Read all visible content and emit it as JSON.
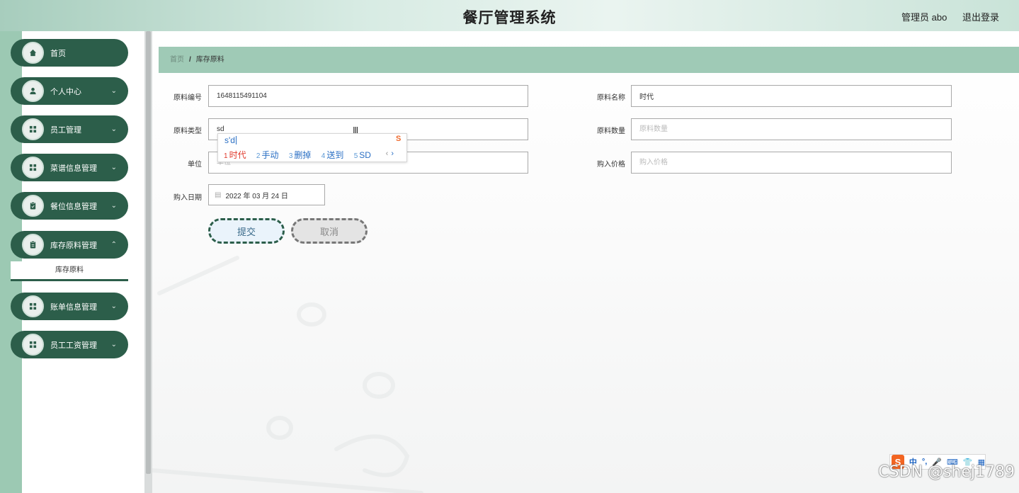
{
  "header": {
    "title": "餐厅管理系统",
    "user": "管理员 abo",
    "logout": "退出登录"
  },
  "sidebar": {
    "items": [
      {
        "label": "首页",
        "icon": "home-icon",
        "has_children": false
      },
      {
        "label": "个人中心",
        "icon": "user-icon",
        "has_children": true
      },
      {
        "label": "员工管理",
        "icon": "grid-icon",
        "has_children": true
      },
      {
        "label": "菜谱信息管理",
        "icon": "grid-icon",
        "has_children": true
      },
      {
        "label": "餐位信息管理",
        "icon": "clipboard-icon",
        "has_children": true
      },
      {
        "label": "库存原料管理",
        "icon": "document-icon",
        "has_children": true,
        "expanded": true
      },
      {
        "label": "账单信息管理",
        "icon": "grid-icon",
        "has_children": true
      },
      {
        "label": "员工工资管理",
        "icon": "grid-icon",
        "has_children": true
      }
    ],
    "submenu": [
      "库存原料"
    ]
  },
  "breadcrumb": {
    "home": "首页",
    "separator": "/",
    "current": "库存原料"
  },
  "form": {
    "code_label": "原料编号",
    "code_value": "1648115491104",
    "name_label": "原料名称",
    "name_value": "时代",
    "type_label": "原料类型",
    "type_value": "sd",
    "qty_label": "原料数量",
    "qty_placeholder": "原料数量",
    "unit_label": "单位",
    "unit_placeholder": "单位",
    "price_label": "购入价格",
    "price_placeholder": "购入价格",
    "date_label": "购入日期",
    "date_value": "2022 年 03 月 24 日",
    "submit": "提交",
    "cancel": "取消"
  },
  "ime_popup": {
    "pinyin": "s'd",
    "candidates": [
      {
        "n": "1",
        "text": "时代"
      },
      {
        "n": "2",
        "text": "手动"
      },
      {
        "n": "3",
        "text": "删掉"
      },
      {
        "n": "4",
        "text": "送到"
      },
      {
        "n": "5",
        "text": "SD"
      }
    ],
    "prev": "‹",
    "next": "›"
  },
  "ime_toolbar": {
    "logo": "S",
    "items": [
      "中",
      "°,",
      "🎤",
      "⌨",
      "👕",
      "▦"
    ]
  },
  "watermark": "CSDN @shej1789",
  "colors": {
    "sidebar_item_bg": "#2c5e4a",
    "left_strip": "#9cc9b3",
    "breadcrumb_bg": "#9fcab6",
    "ime_first_candidate": "#e0392b",
    "ime_candidate": "#2a6fc4"
  }
}
